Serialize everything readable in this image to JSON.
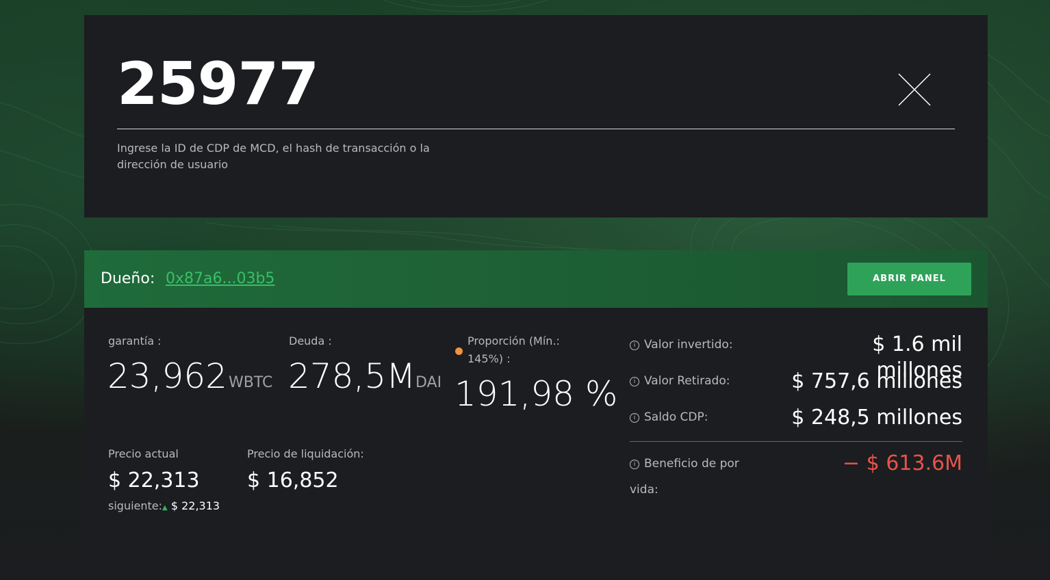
{
  "search": {
    "value": "25977",
    "hint": "Ingrese la ID de CDP de MCD, el hash de transacción o la dirección de usuario"
  },
  "owner": {
    "label": "Dueño:",
    "address": "0x87a6...03b5",
    "open_panel": "ABRIR PANEL"
  },
  "collateral": {
    "label": "garantía :",
    "value": "23,962",
    "unit": "WBTC"
  },
  "debt": {
    "label": "Deuda :",
    "value": "278,5M",
    "unit": "DAI"
  },
  "ratio": {
    "label_line1": "Proporción (Mín.:",
    "label_line2": "145%) :",
    "value": "191,98 %",
    "status_color": "#f0923e"
  },
  "price": {
    "label": "Precio actual",
    "value": "$ 22,313",
    "next_label": "siguiente:",
    "next_value": "$ 22,313"
  },
  "liquidation": {
    "label": "Precio de liquidación:",
    "value": "$ 16,852"
  },
  "summary": {
    "invested_label": "Valor invertido:",
    "invested_value_line1": "$ 1.6 mil",
    "invested_value_line2": "millones",
    "withdrawn_label": "Valor Retirado:",
    "withdrawn_value": "$ 757,6 millones",
    "balance_label": "Saldo CDP:",
    "balance_value": "$ 248,5 millones",
    "profit_label_line1": "Beneficio de por",
    "profit_label_line2": "vida:",
    "profit_value": "− $ 613.6M"
  },
  "colors": {
    "accent_green": "#2fa25a",
    "link_green": "#3bbd6a",
    "negative_red": "#e8534a",
    "card_bg": "#1c1d20"
  }
}
